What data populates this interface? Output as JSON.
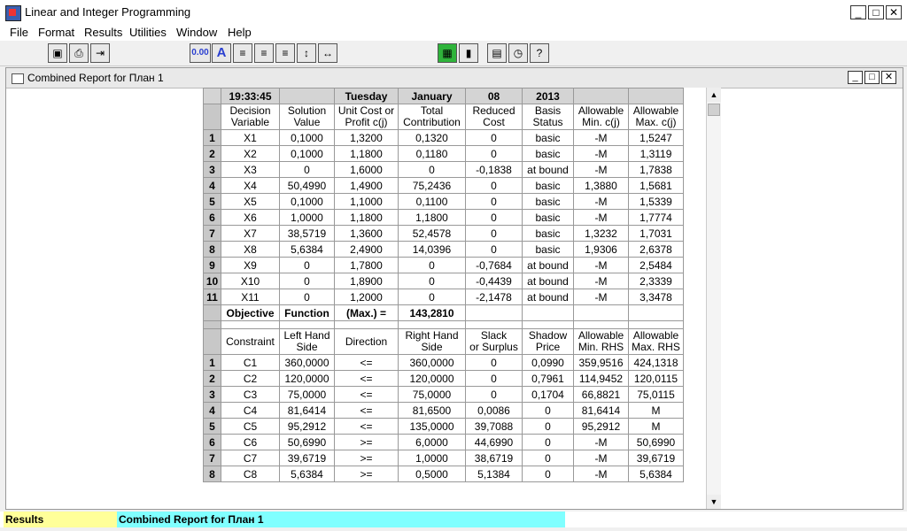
{
  "app": {
    "title": "Linear and Integer Programming"
  },
  "menu": [
    "File",
    "Format",
    "Results",
    "Utilities",
    "Window",
    "Help"
  ],
  "toolbar": {
    "decimals_label": "0.00",
    "font_label": "A"
  },
  "child": {
    "title": "Combined Report for План 1"
  },
  "report": {
    "date_row": [
      "19:33:45",
      "",
      "Tuesday",
      "January",
      "08",
      "2013",
      "",
      ""
    ],
    "var_headers": [
      "Decision\nVariable",
      "Solution\nValue",
      "Unit Cost or\nProfit c(j)",
      "Total\nContribution",
      "Reduced\nCost",
      "Basis\nStatus",
      "Allowable\nMin. c(j)",
      "Allowable\nMax. c(j)"
    ],
    "variables": [
      [
        "1",
        "X1",
        "0,1000",
        "1,3200",
        "0,1320",
        "0",
        "basic",
        "-M",
        "1,5247"
      ],
      [
        "2",
        "X2",
        "0,1000",
        "1,1800",
        "0,1180",
        "0",
        "basic",
        "-M",
        "1,3119"
      ],
      [
        "3",
        "X3",
        "0",
        "1,6000",
        "0",
        "-0,1838",
        "at bound",
        "-M",
        "1,7838"
      ],
      [
        "4",
        "X4",
        "50,4990",
        "1,4900",
        "75,2436",
        "0",
        "basic",
        "1,3880",
        "1,5681"
      ],
      [
        "5",
        "X5",
        "0,1000",
        "1,1000",
        "0,1100",
        "0",
        "basic",
        "-M",
        "1,5339"
      ],
      [
        "6",
        "X6",
        "1,0000",
        "1,1800",
        "1,1800",
        "0",
        "basic",
        "-M",
        "1,7774"
      ],
      [
        "7",
        "X7",
        "38,5719",
        "1,3600",
        "52,4578",
        "0",
        "basic",
        "1,3232",
        "1,7031"
      ],
      [
        "8",
        "X8",
        "5,6384",
        "2,4900",
        "14,0396",
        "0",
        "basic",
        "1,9306",
        "2,6378"
      ],
      [
        "9",
        "X9",
        "0",
        "1,7800",
        "0",
        "-0,7684",
        "at bound",
        "-M",
        "2,5484"
      ],
      [
        "10",
        "X10",
        "0",
        "1,8900",
        "0",
        "-0,4439",
        "at bound",
        "-M",
        "2,3339"
      ],
      [
        "11",
        "X11",
        "0",
        "1,2000",
        "0",
        "-2,1478",
        "at bound",
        "-M",
        "3,3478"
      ]
    ],
    "objective_row": [
      "Objective",
      "Function",
      "(Max.) =",
      "143,2810",
      "",
      "",
      "",
      ""
    ],
    "con_headers": [
      "Constraint",
      "Left Hand\nSide",
      "Direction",
      "Right Hand\nSide",
      "Slack\nor Surplus",
      "Shadow\nPrice",
      "Allowable\nMin. RHS",
      "Allowable\nMax. RHS"
    ],
    "constraints": [
      [
        "1",
        "C1",
        "360,0000",
        "<=",
        "360,0000",
        "0",
        "0,0990",
        "359,9516",
        "424,1318"
      ],
      [
        "2",
        "C2",
        "120,0000",
        "<=",
        "120,0000",
        "0",
        "0,7961",
        "114,9452",
        "120,0115"
      ],
      [
        "3",
        "C3",
        "75,0000",
        "<=",
        "75,0000",
        "0",
        "0,1704",
        "66,8821",
        "75,0115"
      ],
      [
        "4",
        "C4",
        "81,6414",
        "<=",
        "81,6500",
        "0,0086",
        "0",
        "81,6414",
        "M"
      ],
      [
        "5",
        "C5",
        "95,2912",
        "<=",
        "135,0000",
        "39,7088",
        "0",
        "95,2912",
        "M"
      ],
      [
        "6",
        "C6",
        "50,6990",
        ">=",
        "6,0000",
        "44,6990",
        "0",
        "-M",
        "50,6990"
      ],
      [
        "7",
        "C7",
        "39,6719",
        ">=",
        "1,0000",
        "38,6719",
        "0",
        "-M",
        "39,6719"
      ],
      [
        "8",
        "C8",
        "5,6384",
        ">=",
        "0,5000",
        "5,1384",
        "0",
        "-M",
        "5,6384"
      ]
    ]
  },
  "status": {
    "left": "Results",
    "mid": "Combined Report for План 1"
  }
}
